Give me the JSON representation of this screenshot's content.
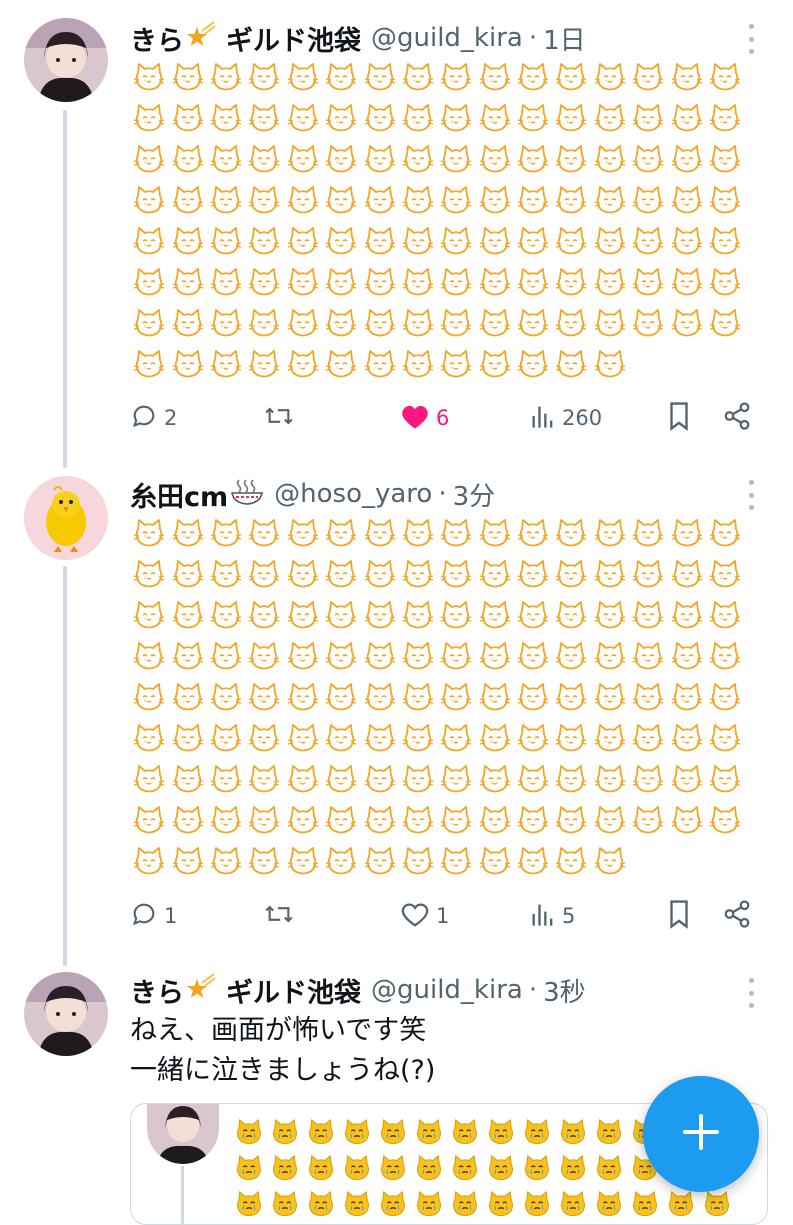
{
  "tweets": [
    {
      "name": "きら",
      "decoration_icon": "shooting-star-icon",
      "name_suffix": "ギルド池袋",
      "handle": "@guild_kira",
      "separator": "·",
      "time": "1日",
      "content_emoji": "crying-cat-emoji",
      "emoji_count": 125,
      "stats": {
        "replies": "2",
        "retweets": "",
        "likes": "6",
        "views": "260"
      },
      "liked": true
    },
    {
      "name": "糸田cm",
      "decoration_icon": "ramen-bowl-icon",
      "handle": "@hoso_yaro",
      "separator": "·",
      "time": "3分",
      "content_emoji": "crying-cat-emoji",
      "emoji_count": 141,
      "stats": {
        "replies": "1",
        "retweets": "",
        "likes": "1",
        "views": "5"
      },
      "liked": false
    },
    {
      "name": "きら",
      "decoration_icon": "shooting-star-icon",
      "name_suffix": "ギルド池袋",
      "handle": "@guild_kira",
      "separator": "·",
      "time": "3秒",
      "text_line1": "ねえ、画面が怖いです笑",
      "text_line2": "一緒に泣きましょうね(?)",
      "quote": {
        "content_emoji": "crying-cat-face-emoji"
      }
    }
  ],
  "fab": {
    "icon": "plus-icon",
    "color": "#1d9bf0"
  },
  "colors": {
    "emoji_outline": "#f4a623",
    "like": "#f91880",
    "muted": "#536471",
    "thread_line": "#cfd9de"
  }
}
